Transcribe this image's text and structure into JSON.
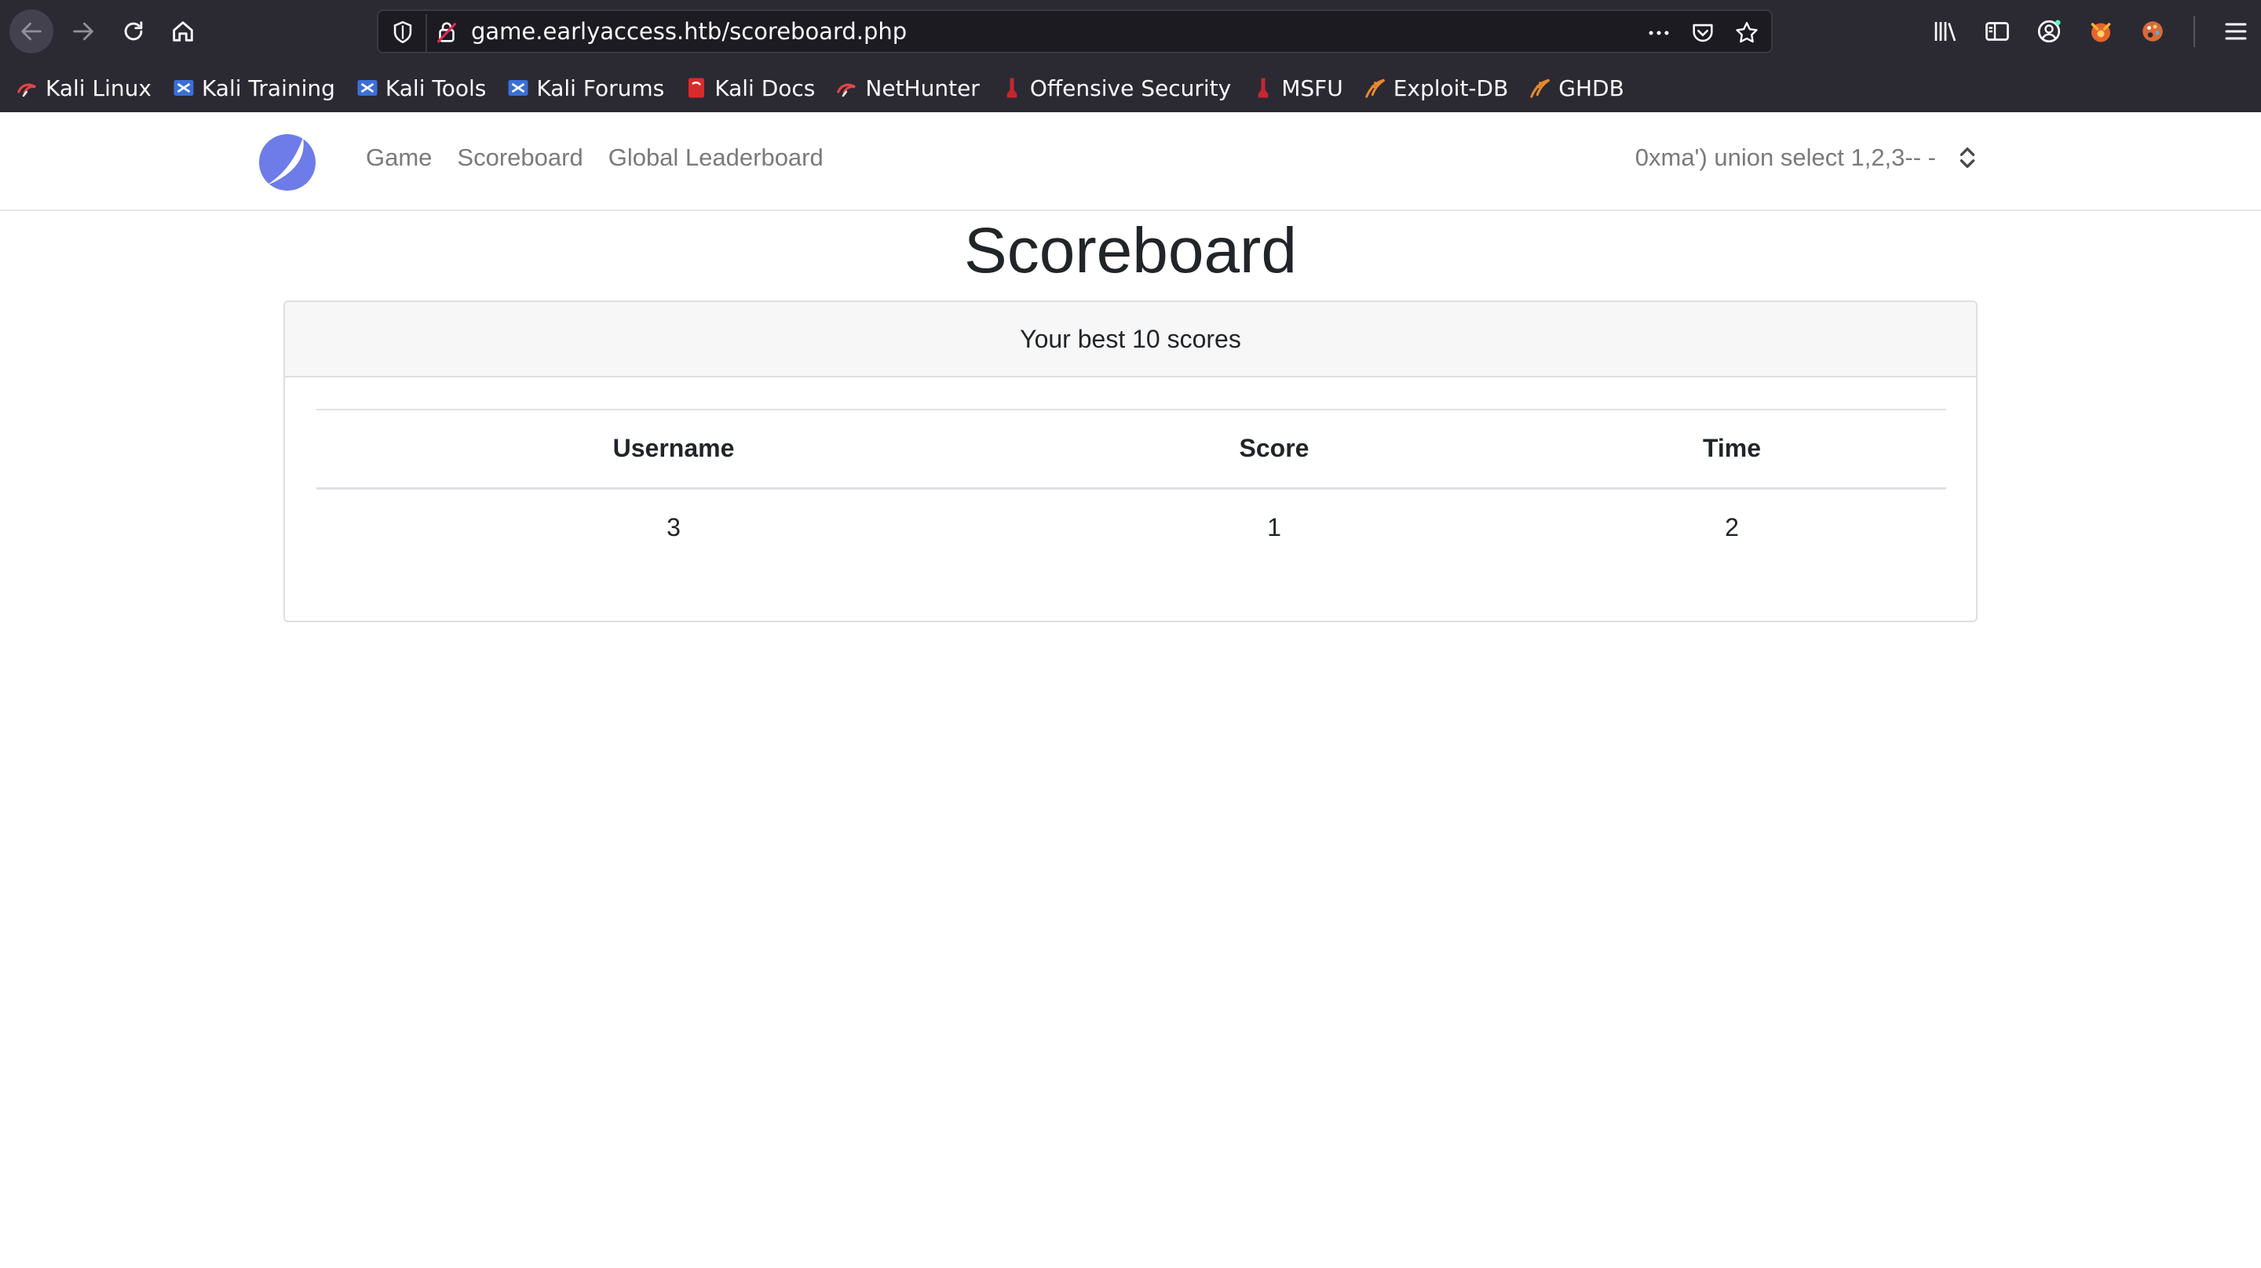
{
  "browser": {
    "url": "game.earlyaccess.htb/scoreboard.php",
    "bookmarks": [
      {
        "label": "Kali Linux",
        "icon": "kali-dragon-icon"
      },
      {
        "label": "Kali Training",
        "icon": "kali-training-icon"
      },
      {
        "label": "Kali Tools",
        "icon": "kali-tools-icon"
      },
      {
        "label": "Kali Forums",
        "icon": "kali-forums-icon"
      },
      {
        "label": "Kali Docs",
        "icon": "kali-docs-icon"
      },
      {
        "label": "NetHunter",
        "icon": "nethunter-icon"
      },
      {
        "label": "Offensive Security",
        "icon": "offsec-icon"
      },
      {
        "label": "MSFU",
        "icon": "msfu-icon"
      },
      {
        "label": "Exploit-DB",
        "icon": "exploitdb-icon"
      },
      {
        "label": "GHDB",
        "icon": "ghdb-icon"
      }
    ]
  },
  "navbar": {
    "links": [
      {
        "label": "Game"
      },
      {
        "label": "Scoreboard"
      },
      {
        "label": "Global Leaderboard"
      }
    ],
    "user": "0xma') union select 1,2,3-- -"
  },
  "page": {
    "title": "Scoreboard",
    "card_header": "Your best 10 scores",
    "table": {
      "headers": [
        "Username",
        "Score",
        "Time"
      ],
      "rows": [
        [
          "3",
          "1",
          "2"
        ]
      ]
    }
  },
  "colors": {
    "chrome_bg": "#2b2a33",
    "logo": "#6d7ce8",
    "nav_text": "#7a7a7a"
  }
}
